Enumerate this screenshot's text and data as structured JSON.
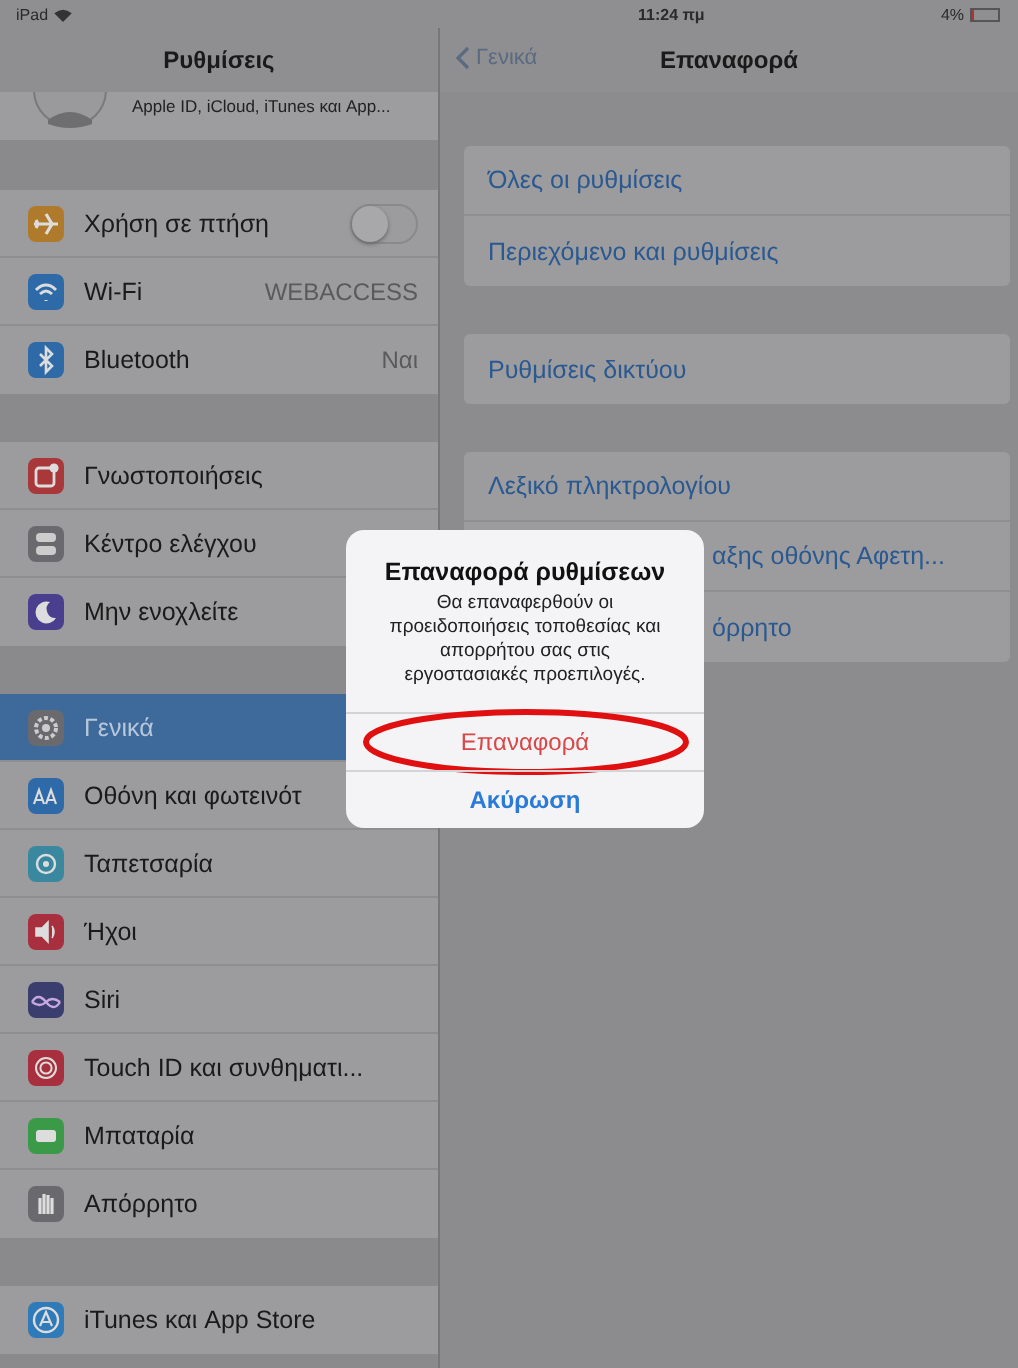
{
  "status_bar": {
    "device": "iPad",
    "time": "11:24 πμ",
    "battery": "4%"
  },
  "sidebar": {
    "title": "Ρυθμίσεις",
    "profile_subtitle": "Apple ID, iCloud, iTunes και App...",
    "groups": [
      [
        {
          "label": "Χρήση σε πτήση",
          "kind": "toggle",
          "on": false,
          "selected": false,
          "color": "#b07a2c"
        },
        {
          "label": "Wi-Fi",
          "kind": "value",
          "value": "WEBACCESS",
          "selected": false,
          "color": "#2f6aa8"
        },
        {
          "label": "Bluetooth",
          "kind": "value",
          "value": "Ναι",
          "selected": false,
          "color": "#2f6aa8"
        }
      ],
      [
        {
          "label": "Γνωστοποιήσεις",
          "kind": "plain",
          "selected": false,
          "color": "#a8383a"
        },
        {
          "label": "Κέντρο ελέγχου",
          "kind": "plain",
          "selected": false,
          "color": "#6a6a6e"
        },
        {
          "label": "Μην ενοχλείτε",
          "kind": "plain",
          "selected": false,
          "color": "#4a3f8e"
        }
      ],
      [
        {
          "label": "Γενικά",
          "kind": "plain",
          "selected": true,
          "color": "#6a6a6e"
        },
        {
          "label": "Οθόνη και φωτεινότ",
          "kind": "plain",
          "selected": false,
          "color": "#2f6aa8"
        },
        {
          "label": "Ταπετσαρία",
          "kind": "plain",
          "selected": false,
          "color": "#3a88a0"
        },
        {
          "label": "Ήχοι",
          "kind": "plain",
          "selected": false,
          "color": "#a8303e"
        },
        {
          "label": "Siri",
          "kind": "plain",
          "selected": false,
          "color": "#3a3e6e"
        },
        {
          "label": "Touch ID και συνθηματι...",
          "kind": "plain",
          "selected": false,
          "color": "#a8303e"
        },
        {
          "label": "Μπαταρία",
          "kind": "plain",
          "selected": false,
          "color": "#3a9a48"
        },
        {
          "label": "Απόρρητο",
          "kind": "plain",
          "selected": false,
          "color": "#6a6a6e"
        }
      ],
      [
        {
          "label": "iTunes και App Store",
          "kind": "plain",
          "selected": false,
          "color": "#2f7ab8"
        }
      ]
    ]
  },
  "detail": {
    "back": "Γενικά",
    "title": "Επαναφορά",
    "groups": [
      [
        {
          "label": "Όλες οι ρυθμίσεις",
          "kind": "plain"
        },
        {
          "label": "Περιεχόμενο και ρυθμίσεις",
          "kind": "plain"
        }
      ],
      [
        {
          "label": "Ρυθμίσεις δικτύου",
          "kind": "plain"
        }
      ],
      [
        {
          "label": "Λεξικό πληκτρολογίου",
          "kind": "plain"
        },
        {
          "label": "αξης οθόνης Αφετη...",
          "kind": "covered"
        },
        {
          "label": "όρρητο",
          "kind": "covered"
        }
      ]
    ]
  },
  "dialog": {
    "title": "Επαναφορά ρυθμίσεων",
    "message": "Θα επαναφερθούν οι προειδοποιήσεις τοποθεσίας και απορρήτου σας στις εργοστασιακές προεπιλογές.",
    "buttons": [
      {
        "label": "Επαναφορά",
        "kind": "destructive",
        "annotated": true
      },
      {
        "label": "Ακύρωση",
        "kind": "cancel",
        "annotated": false
      }
    ]
  }
}
